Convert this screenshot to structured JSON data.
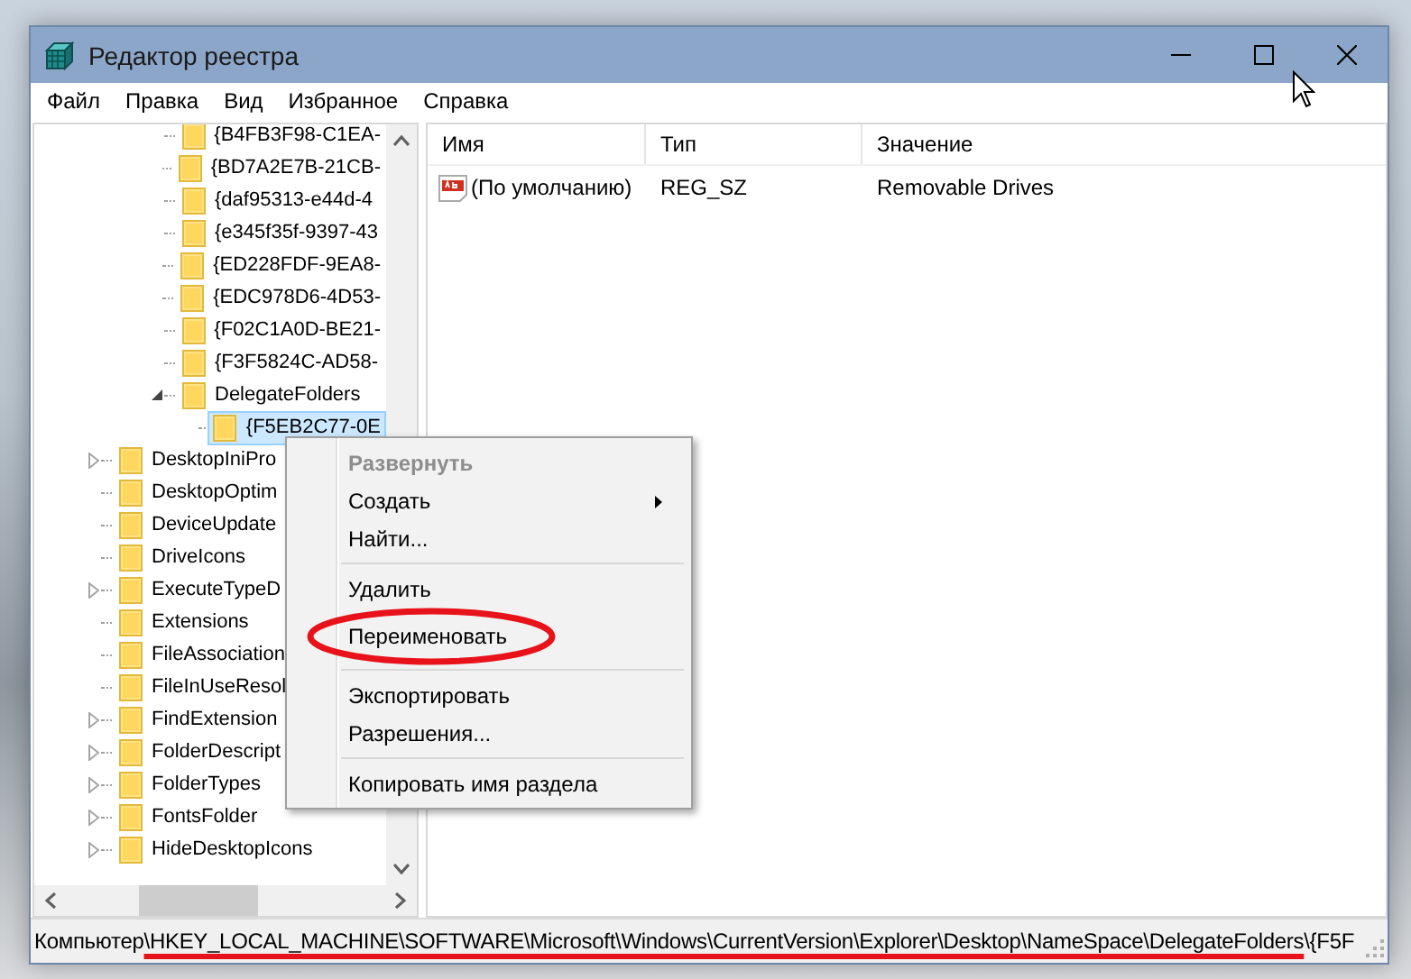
{
  "window": {
    "title": "Редактор реестра"
  },
  "menu_bar": [
    "Файл",
    "Правка",
    "Вид",
    "Избранное",
    "Справка"
  ],
  "tree": {
    "continued_items": [
      {
        "label": "{B4FB3F98-C1EA-",
        "has_children": false,
        "selected": false
      },
      {
        "label": "{BD7A2E7B-21CB-",
        "has_children": false,
        "selected": false
      },
      {
        "label": "{daf95313-e44d-4",
        "has_children": false,
        "selected": false
      },
      {
        "label": "{e345f35f-9397-43",
        "has_children": false,
        "selected": false
      },
      {
        "label": "{ED228FDF-9EA8-",
        "has_children": false,
        "selected": false
      },
      {
        "label": "{EDC978D6-4D53-",
        "has_children": false,
        "selected": false
      },
      {
        "label": "{F02C1A0D-BE21-",
        "has_children": false,
        "selected": false
      },
      {
        "label": "{F3F5824C-AD58-",
        "has_children": false,
        "selected": false
      },
      {
        "label": "DelegateFolders",
        "has_children": true,
        "expanded": true,
        "selected": false,
        "children": [
          {
            "label": "{F5EB2C77-0E",
            "has_children": false,
            "selected": true
          }
        ]
      }
    ],
    "items": [
      {
        "label": "DesktopIniPro",
        "has_children": true,
        "expanded": false,
        "selected": false
      },
      {
        "label": "DesktopOptim",
        "has_children": false,
        "selected": false
      },
      {
        "label": "DeviceUpdate",
        "has_children": false,
        "selected": false
      },
      {
        "label": "DriveIcons",
        "has_children": false,
        "selected": false
      },
      {
        "label": "ExecuteTypeD",
        "has_children": true,
        "expanded": false,
        "selected": false
      },
      {
        "label": "Extensions",
        "has_children": false,
        "selected": false
      },
      {
        "label": "FileAssociation",
        "has_children": false,
        "selected": false
      },
      {
        "label": "FileInUseResol",
        "has_children": false,
        "selected": false
      },
      {
        "label": "FindExtension",
        "has_children": true,
        "expanded": false,
        "selected": false
      },
      {
        "label": "FolderDescript",
        "has_children": true,
        "expanded": false,
        "selected": false
      },
      {
        "label": "FolderTypes",
        "has_children": true,
        "expanded": false,
        "selected": false
      },
      {
        "label": "FontsFolder",
        "has_children": true,
        "expanded": false,
        "selected": false
      },
      {
        "label": "HideDesktopIcons",
        "has_children": true,
        "expanded": false,
        "selected": false
      }
    ]
  },
  "table": {
    "columns": [
      "Имя",
      "Тип",
      "Значение"
    ],
    "rows": [
      {
        "name": "(По умолчанию)",
        "type": "REG_SZ",
        "value": "Removable Drives"
      }
    ]
  },
  "context_menu": {
    "items": [
      {
        "kind": "item",
        "label": "Развернуть",
        "default": true,
        "disabled": true,
        "submenu": false,
        "circled": false
      },
      {
        "kind": "item",
        "label": "Создать",
        "default": false,
        "disabled": false,
        "submenu": true,
        "circled": false
      },
      {
        "kind": "item",
        "label": "Найти...",
        "default": false,
        "disabled": false,
        "submenu": false,
        "circled": false
      },
      {
        "kind": "separator"
      },
      {
        "kind": "item",
        "label": "Удалить",
        "default": false,
        "disabled": false,
        "submenu": false,
        "circled": false
      },
      {
        "kind": "item",
        "label": "Переименовать",
        "default": false,
        "disabled": false,
        "submenu": false,
        "circled": true
      },
      {
        "kind": "separator"
      },
      {
        "kind": "item",
        "label": "Экспортировать",
        "default": false,
        "disabled": false,
        "submenu": false,
        "circled": false
      },
      {
        "kind": "item",
        "label": "Разрешения...",
        "default": false,
        "disabled": false,
        "submenu": false,
        "circled": false
      },
      {
        "kind": "separator"
      },
      {
        "kind": "item",
        "label": "Копировать имя раздела",
        "default": false,
        "disabled": false,
        "submenu": false,
        "circled": false
      }
    ]
  },
  "status_bar": {
    "segments": [
      {
        "text": "Компьютер",
        "underlined": false
      },
      {
        "text": "\\HKEY_LOCAL_MACHINE\\SOFTWARE\\Microsoft\\Windows\\CurrentVersion\\Explorer\\Desktop\\NameSpace\\DelegateFolders",
        "underlined": true
      },
      {
        "text": "\\{F5F",
        "underlined": false
      }
    ]
  }
}
